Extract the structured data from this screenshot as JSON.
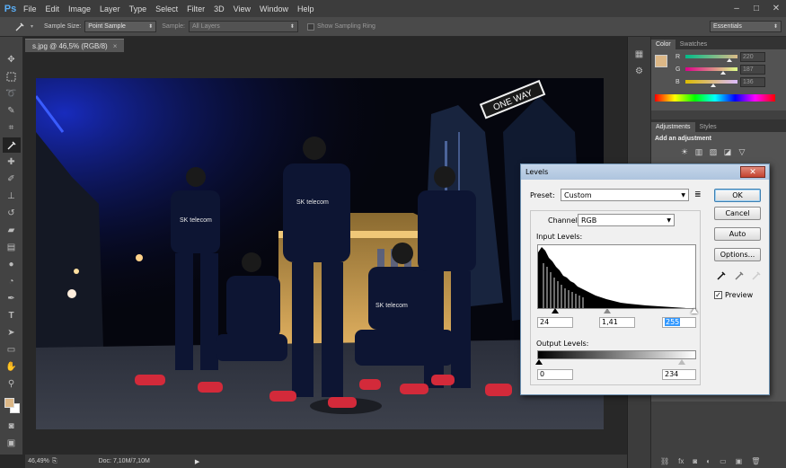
{
  "app": {
    "logo": "Ps",
    "menu": [
      "File",
      "Edit",
      "Image",
      "Layer",
      "Type",
      "Select",
      "Filter",
      "3D",
      "View",
      "Window",
      "Help"
    ],
    "window_controls": [
      "–",
      "□",
      "✕"
    ]
  },
  "options_bar": {
    "sample_size_label": "Sample Size:",
    "sample_size_value": "Point Sample",
    "sample_label": "Sample:",
    "sample_value": "All Layers",
    "show_ring_label": "Show Sampling Ring",
    "workspace": "Essentials"
  },
  "document": {
    "tab_title": "s.jpg @ 46,5% (RGB/8)",
    "tab_close": "×"
  },
  "status_bar": {
    "zoom": "46,49%",
    "doc_info": "Doc: 7,10M/7,10M"
  },
  "colors": {
    "foreground": "#dcb786",
    "background": "#ffffff",
    "highlight": "#3399ff"
  },
  "color_panel": {
    "tabs": [
      "Color",
      "Swatches"
    ],
    "channels": [
      {
        "label": "R",
        "value": "220",
        "level": 0.863
      },
      {
        "label": "G",
        "value": "187",
        "level": 0.733
      },
      {
        "label": "B",
        "value": "136",
        "level": 0.533
      }
    ]
  },
  "adjustments_panel": {
    "tabs": [
      "Adjustments",
      "Styles"
    ],
    "heading": "Add an adjustment"
  },
  "levels_dialog": {
    "title": "Levels",
    "close": "✕",
    "preset_label": "Preset:",
    "preset_value": "Custom",
    "channel_label": "Channel:",
    "channel_value": "RGB",
    "input_levels_label": "Input Levels:",
    "input_black": "24",
    "input_gamma": "1,41",
    "input_white": "255",
    "output_levels_label": "Output Levels:",
    "output_black": "0",
    "output_white": "234",
    "buttons": {
      "ok": "OK",
      "cancel": "Cancel",
      "auto": "Auto",
      "options": "Options..."
    },
    "preview_label": "Preview",
    "preview_checked": true,
    "histogram_note": "Histogram heavily weighted to dark tones, decaying toward highlights"
  },
  "photo": {
    "sign_text": "ONE WAY",
    "jersey_text": "SK telecom"
  }
}
